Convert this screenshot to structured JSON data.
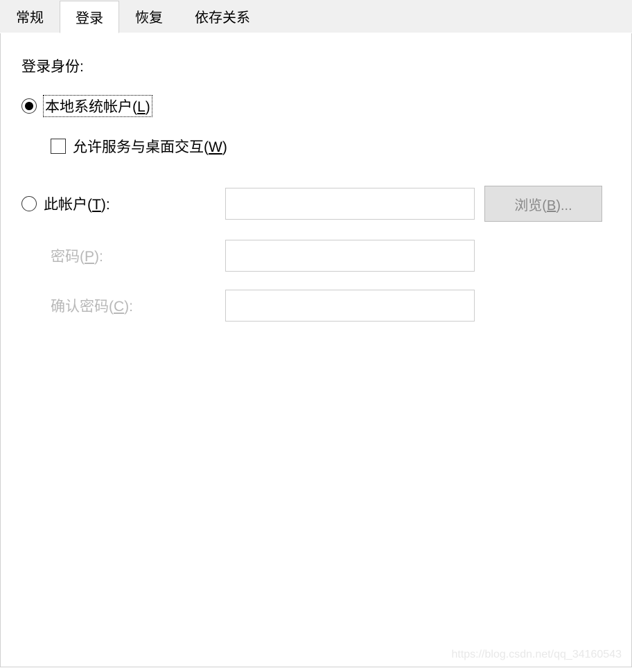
{
  "tabs": {
    "general": "常规",
    "login": "登录",
    "recovery": "恢复",
    "dependencies": "依存关系"
  },
  "panel": {
    "section_label": "登录身份:",
    "local_system": {
      "label_prefix": "本地系统帐户(",
      "label_key": "L",
      "label_suffix": ")"
    },
    "allow_desktop": {
      "label_prefix": "允许服务与桌面交互(",
      "label_key": "W",
      "label_suffix": ")"
    },
    "this_account": {
      "label_prefix": "此帐户(",
      "label_key": "T",
      "label_suffix": "):"
    },
    "password": {
      "label_prefix": "密码(",
      "label_key": "P",
      "label_suffix": "):"
    },
    "confirm_password": {
      "label_prefix": "确认密码(",
      "label_key": "C",
      "label_suffix": "):"
    },
    "browse": {
      "label_prefix": "浏览(",
      "label_key": "B",
      "label_suffix": ")..."
    }
  },
  "watermark": "https://blog.csdn.net/qq_34160543"
}
